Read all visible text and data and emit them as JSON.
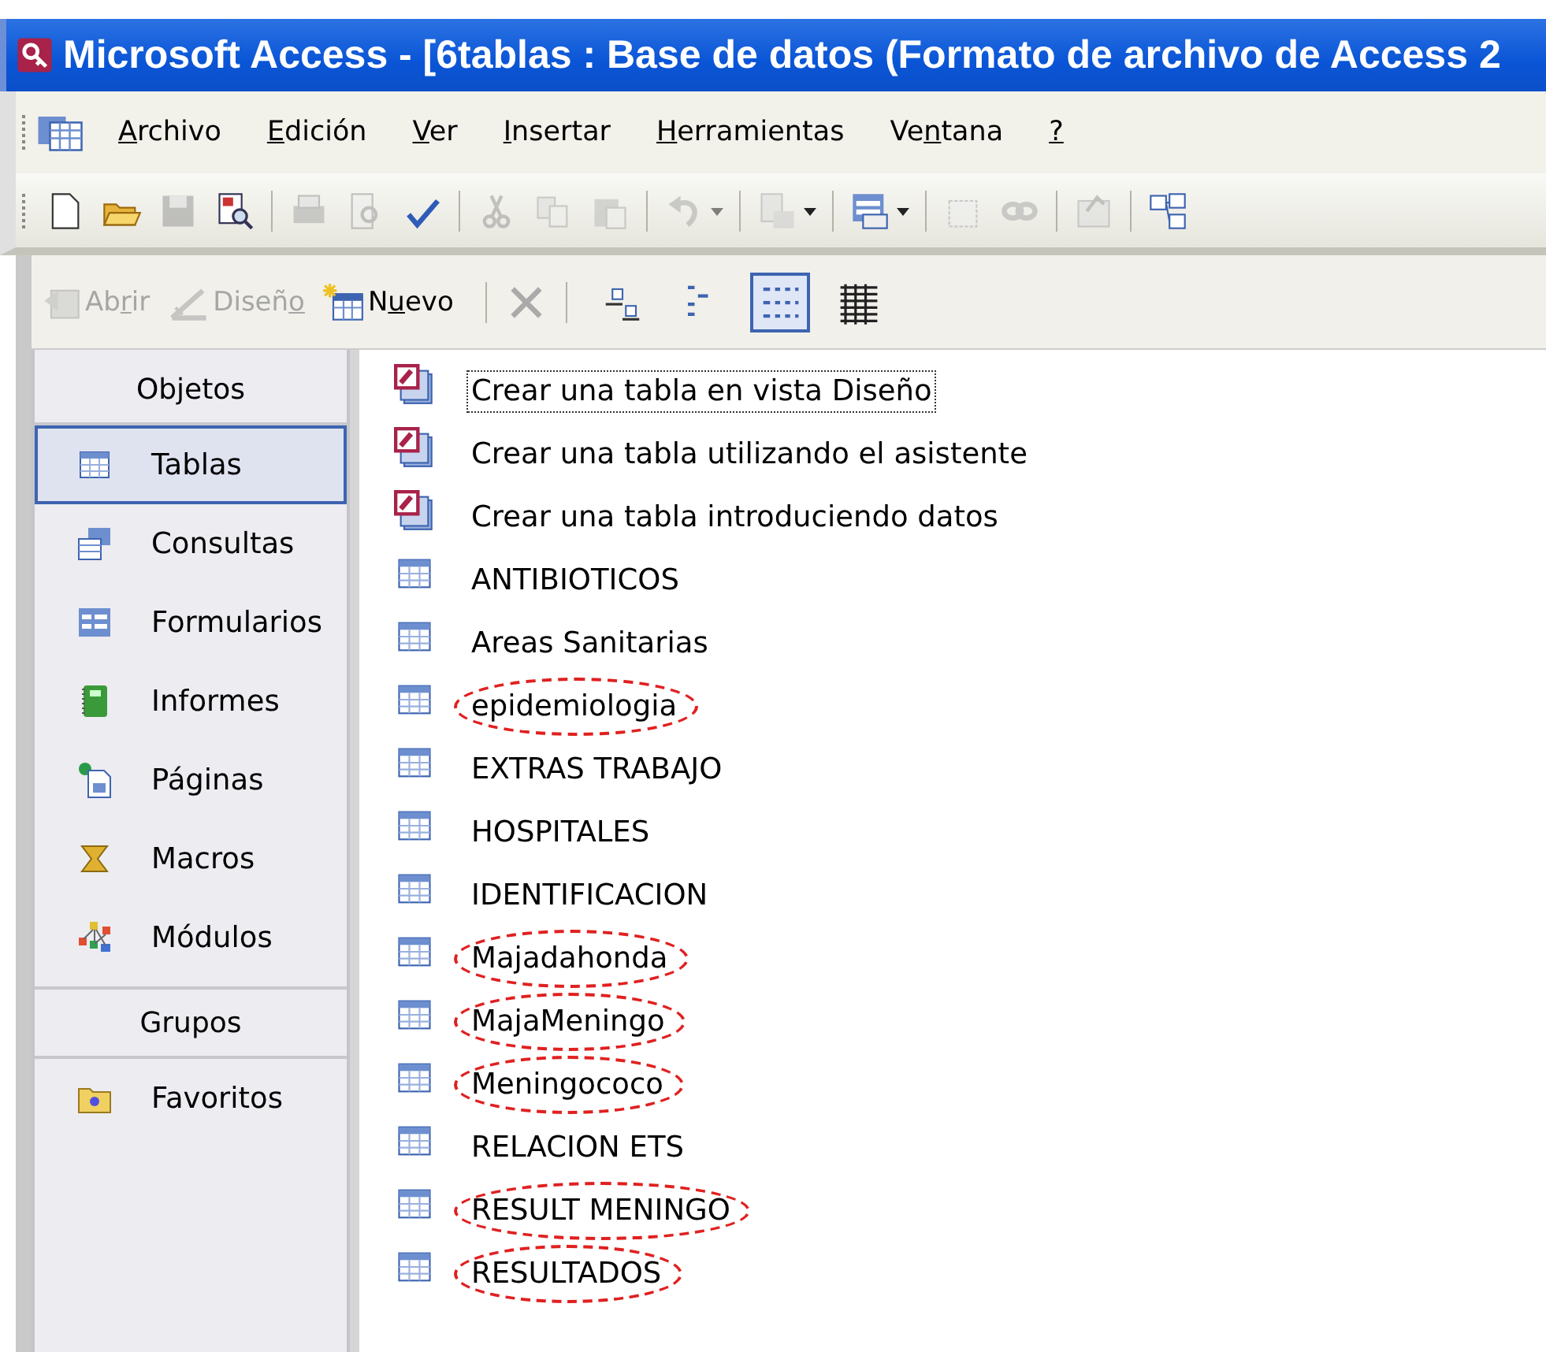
{
  "window": {
    "title": "Microsoft Access - [6tablas : Base de datos (Formato de archivo de Access 2"
  },
  "menu": [
    {
      "key": "A",
      "post": "rchivo"
    },
    {
      "key": "E",
      "post": "dición"
    },
    {
      "key": "V",
      "post": "er"
    },
    {
      "key": "I",
      "post": "nsertar"
    },
    {
      "key": "H",
      "post": "erramientas"
    },
    {
      "pre": "Ve",
      "key": "n",
      "post": "tana"
    },
    {
      "key": "?"
    }
  ],
  "toolbar": [
    {
      "kind": "new",
      "disabled": false
    },
    {
      "kind": "open",
      "disabled": false
    },
    {
      "kind": "save",
      "disabled": true
    },
    {
      "kind": "search",
      "disabled": false
    },
    {
      "kind": "sep"
    },
    {
      "kind": "print",
      "disabled": true
    },
    {
      "kind": "preview",
      "disabled": true
    },
    {
      "kind": "spell",
      "disabled": false
    },
    {
      "kind": "sep"
    },
    {
      "kind": "cut",
      "disabled": true
    },
    {
      "kind": "copy",
      "disabled": true
    },
    {
      "kind": "paste",
      "disabled": true
    },
    {
      "kind": "sep"
    },
    {
      "kind": "undo",
      "disabled": true
    },
    {
      "kind": "drop",
      "disabled": true
    },
    {
      "kind": "sep"
    },
    {
      "kind": "links",
      "disabled": true
    },
    {
      "kind": "drop",
      "disabled": false
    },
    {
      "kind": "sep"
    },
    {
      "kind": "analyze",
      "disabled": false
    },
    {
      "kind": "drop",
      "disabled": false
    },
    {
      "kind": "sep"
    },
    {
      "kind": "code",
      "disabled": true
    },
    {
      "kind": "chain",
      "disabled": true
    },
    {
      "kind": "sep"
    },
    {
      "kind": "props",
      "disabled": true
    },
    {
      "kind": "sep"
    },
    {
      "kind": "relations",
      "disabled": false
    }
  ],
  "db_toolbar": {
    "actions": [
      {
        "kind": "open",
        "pre": "Ab",
        "key": "r",
        "post": "ir",
        "disabled": true
      },
      {
        "kind": "design",
        "pre": "Diseñ",
        "key": "o",
        "disabled": true
      },
      {
        "kind": "new",
        "pre": "N",
        "key": "u",
        "post": "evo",
        "disabled": false
      }
    ],
    "views": [
      {
        "kind": "large",
        "selected": false
      },
      {
        "kind": "small",
        "selected": false
      },
      {
        "kind": "list",
        "selected": true
      },
      {
        "kind": "details",
        "selected": false
      }
    ]
  },
  "sidebar": {
    "objects_header": "Objetos",
    "items": [
      {
        "kind": "tables",
        "label": "Tablas",
        "selected": true
      },
      {
        "kind": "queries",
        "label": "Consultas",
        "selected": false
      },
      {
        "kind": "forms",
        "label": "Formularios",
        "selected": false
      },
      {
        "kind": "reports",
        "label": "Informes",
        "selected": false
      },
      {
        "kind": "pages",
        "label": "Páginas",
        "selected": false
      },
      {
        "kind": "macros",
        "label": "Macros",
        "selected": false
      },
      {
        "kind": "modules",
        "label": "Módulos",
        "selected": false
      }
    ],
    "groups_header": "Grupos",
    "groups": [
      {
        "kind": "favorites",
        "label": "Favoritos",
        "selected": false
      }
    ]
  },
  "list": [
    {
      "kind": "wizard",
      "label": "Crear una tabla en vista Diseño",
      "focused": true,
      "circled": false
    },
    {
      "kind": "wizard",
      "label": "Crear una tabla utilizando el asistente",
      "focused": false,
      "circled": false
    },
    {
      "kind": "wizard",
      "label": "Crear una tabla introduciendo datos",
      "focused": false,
      "circled": false
    },
    {
      "kind": "table",
      "label": "ANTIBIOTICOS",
      "focused": false,
      "circled": false
    },
    {
      "kind": "table",
      "label": "Areas Sanitarias",
      "focused": false,
      "circled": false
    },
    {
      "kind": "table",
      "label": "epidemiologia",
      "focused": false,
      "circled": true
    },
    {
      "kind": "table",
      "label": "EXTRAS TRABAJO",
      "focused": false,
      "circled": false
    },
    {
      "kind": "table",
      "label": "HOSPITALES",
      "focused": false,
      "circled": false
    },
    {
      "kind": "table",
      "label": "IDENTIFICACION",
      "focused": false,
      "circled": false
    },
    {
      "kind": "table",
      "label": "Majadahonda",
      "focused": false,
      "circled": true
    },
    {
      "kind": "table",
      "label": "MajaMeningo",
      "focused": false,
      "circled": true
    },
    {
      "kind": "table",
      "label": "Meningococo",
      "focused": false,
      "circled": true
    },
    {
      "kind": "table",
      "label": "RELACION ETS",
      "focused": false,
      "circled": false
    },
    {
      "kind": "table",
      "label": "RESULT MENINGO",
      "focused": false,
      "circled": true
    },
    {
      "kind": "table",
      "label": "RESULTADOS",
      "focused": false,
      "circled": true
    }
  ]
}
